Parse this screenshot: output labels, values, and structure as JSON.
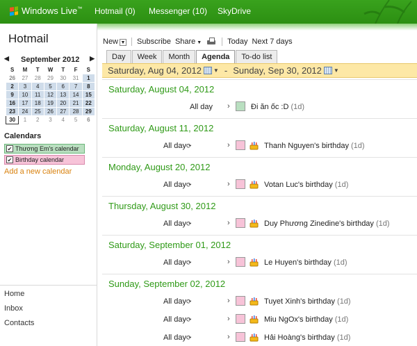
{
  "header": {
    "brand": "Windows Live",
    "brand_mark": "™",
    "nav": [
      "Hotmail (0)",
      "Messenger (10)",
      "SkyDrive"
    ]
  },
  "sidebar": {
    "app_title": "Hotmail",
    "minical": {
      "month_label": "September 2012",
      "weekdays": [
        "S",
        "M",
        "T",
        "W",
        "T",
        "F",
        "S"
      ],
      "weeks": [
        [
          "26",
          "27",
          "28",
          "29",
          "30",
          "31",
          "1"
        ],
        [
          "2",
          "3",
          "4",
          "5",
          "6",
          "7",
          "8"
        ],
        [
          "9",
          "10",
          "11",
          "12",
          "13",
          "14",
          "15"
        ],
        [
          "16",
          "17",
          "18",
          "19",
          "20",
          "21",
          "22"
        ],
        [
          "23",
          "24",
          "25",
          "26",
          "27",
          "28",
          "29"
        ],
        [
          "30",
          "1",
          "2",
          "3",
          "4",
          "5",
          "6"
        ]
      ]
    },
    "calendars_title": "Calendars",
    "calendars": [
      {
        "label": "Thương Em's calendar",
        "color": "#b9dfc0",
        "border": "#6cb67a"
      },
      {
        "label": "Birthday calendar",
        "color": "#f7c3d8",
        "border": "#d989ac"
      }
    ],
    "add_calendar": "Add a new calendar",
    "links": [
      "Home",
      "Inbox",
      "Contacts"
    ]
  },
  "toolbar": {
    "new": "New",
    "subscribe": "Subscribe",
    "share": "Share",
    "today": "Today",
    "next7": "Next 7 days"
  },
  "tabs": [
    "Day",
    "Week",
    "Month",
    "Agenda",
    "To-do list"
  ],
  "active_tab": "Agenda",
  "range": {
    "start": "Saturday, Aug 04, 2012",
    "separator": "-",
    "end": "Sunday, Sep 30, 2012"
  },
  "agenda": [
    {
      "date": "Saturday, August 04, 2012",
      "events": [
        {
          "allday": "All day",
          "recurring": false,
          "birthday": false,
          "title": "Đi ăn ốc :D",
          "duration": "(1d)",
          "swatch": "#b9dfc0"
        }
      ]
    },
    {
      "date": "Saturday, August 11, 2012",
      "events": [
        {
          "allday": "All day",
          "recurring": true,
          "birthday": true,
          "title": "Thanh Nguyen's birthday",
          "duration": "(1d)",
          "swatch": "#f7c3d8"
        }
      ]
    },
    {
      "date": "Monday, August 20, 2012",
      "events": [
        {
          "allday": "All day",
          "recurring": true,
          "birthday": true,
          "title": "Votan Luc's birthday",
          "duration": "(1d)",
          "swatch": "#f7c3d8"
        }
      ]
    },
    {
      "date": "Thursday, August 30, 2012",
      "events": [
        {
          "allday": "All day",
          "recurring": true,
          "birthday": true,
          "title": "Duy Phương Zinedine's birthday",
          "duration": "(1d)",
          "swatch": "#f7c3d8"
        }
      ]
    },
    {
      "date": "Saturday, September 01, 2012",
      "events": [
        {
          "allday": "All day",
          "recurring": true,
          "birthday": true,
          "title": "Le Huyen's birthday",
          "duration": "(1d)",
          "swatch": "#f7c3d8"
        }
      ]
    },
    {
      "date": "Sunday, September 02, 2012",
      "events": [
        {
          "allday": "All day",
          "recurring": true,
          "birthday": true,
          "title": "Tuyet Xinh's birthday",
          "duration": "(1d)",
          "swatch": "#f7c3d8"
        },
        {
          "allday": "All day",
          "recurring": true,
          "birthday": true,
          "title": "Miu NgOx's birthday",
          "duration": "(1d)",
          "swatch": "#f7c3d8"
        },
        {
          "allday": "All day",
          "recurring": true,
          "birthday": true,
          "title": "Hải Hoàng's birthday",
          "duration": "(1d)",
          "swatch": "#f7c3d8"
        }
      ]
    }
  ]
}
